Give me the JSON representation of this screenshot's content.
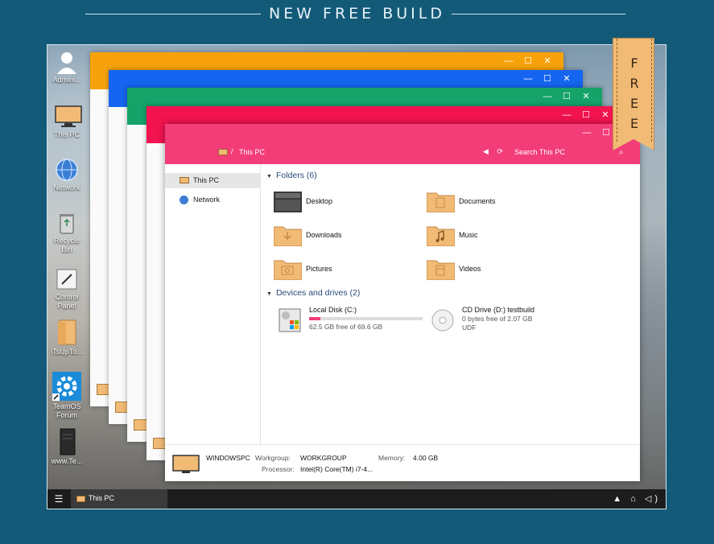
{
  "header": {
    "title": "NEW FREE BUILD"
  },
  "ribbon": {
    "letters": [
      "F",
      "R",
      "E",
      "E"
    ]
  },
  "desktop_icons": [
    {
      "label": "Admini..."
    },
    {
      "label": "This PC"
    },
    {
      "label": "Network"
    },
    {
      "label": "Recycle Bin"
    },
    {
      "label": "Control Panel"
    },
    {
      "label": "iTsUpTo..."
    },
    {
      "label": "TeamOS Forum"
    },
    {
      "label": "www.Te..."
    }
  ],
  "stacked_windows": [
    {
      "accent": "#f7a20a"
    },
    {
      "accent": "#1565f0"
    },
    {
      "accent": "#15a36a"
    },
    {
      "accent": "#f2134f"
    }
  ],
  "window": {
    "accent": "#f23d78",
    "controls": {
      "minimize": "—",
      "maximize": "☐",
      "close": "✕"
    },
    "address": {
      "separator": "/",
      "location": "This PC"
    },
    "nav_arrows": "◀ ⟳",
    "search_placeholder": "Search This PC",
    "search_glyph": "⌕"
  },
  "sidebar": {
    "items": [
      {
        "label": "This PC",
        "selected": true,
        "icon": "pc-icon"
      },
      {
        "label": "Network",
        "selected": false,
        "icon": "network-icon"
      }
    ]
  },
  "folders": {
    "heading": "Folders (6)",
    "chevron": "▼",
    "items": [
      {
        "label": "Desktop",
        "icon": "desktop-folder-icon"
      },
      {
        "label": "Documents",
        "icon": "documents-folder-icon"
      },
      {
        "label": "Downloads",
        "icon": "downloads-folder-icon"
      },
      {
        "label": "Music",
        "icon": "music-folder-icon"
      },
      {
        "label": "Pictures",
        "icon": "pictures-folder-icon"
      },
      {
        "label": "Videos",
        "icon": "videos-folder-icon"
      }
    ]
  },
  "drives": {
    "heading": "Devices and drives (2)",
    "chevron": "▼",
    "items": [
      {
        "name": "Local Disk (C:)",
        "free": "62.5 GB free of 69.6 GB",
        "used_fraction": 0.1,
        "icon": "hard-disk-icon"
      },
      {
        "name": "CD Drive (D:) testbuild",
        "free": "0 bytes free of 2.07 GB",
        "fs": "UDF",
        "icon": "cd-drive-icon"
      }
    ]
  },
  "details": {
    "pc_name": "WINDOWSPC",
    "workgroup_label": "Workgroup:",
    "workgroup": "WORKGROUP",
    "memory_label": "Memory:",
    "memory": "4.00 GB",
    "processor_label": "Processor:",
    "processor": "Intel(R) Core(TM) i7-4..."
  },
  "taskbar": {
    "start_glyph": "☰",
    "task_label": "This PC",
    "tray_glyphs": "▲ ⌂ ◁)"
  }
}
